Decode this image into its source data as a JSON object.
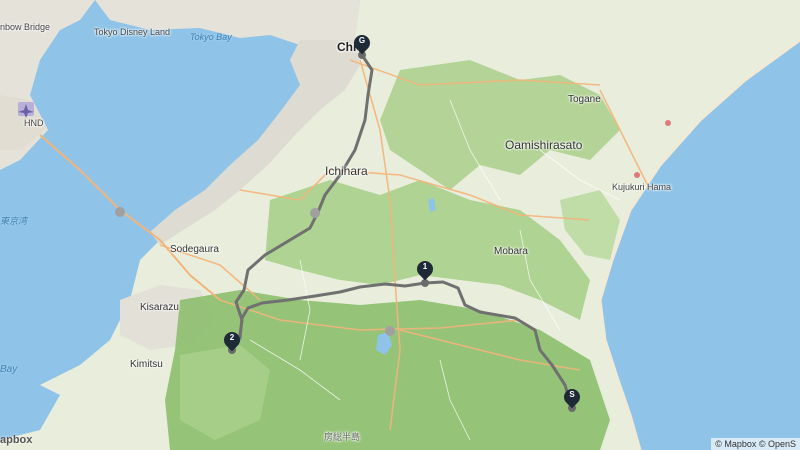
{
  "map": {
    "labels": [
      {
        "id": "rainbow-bridge",
        "text": "nbow Bridge"
      },
      {
        "id": "tokyo-disneyland",
        "text": "Tokyo Disney Land"
      },
      {
        "id": "tokyo-bay",
        "text": "Tokyo Bay"
      },
      {
        "id": "hnd",
        "text": "HND"
      },
      {
        "id": "tokyo-wan",
        "text": "東京湾"
      },
      {
        "id": "chiba",
        "text": "Chi"
      },
      {
        "id": "togane",
        "text": "Togane"
      },
      {
        "id": "oamishirasato",
        "text": "Oamishirasato"
      },
      {
        "id": "ichihara",
        "text": "Ichihara"
      },
      {
        "id": "kujukuri-hama",
        "text": "Kujukuri Hama"
      },
      {
        "id": "sodegaura",
        "text": "Sodegaura"
      },
      {
        "id": "mobara",
        "text": "Mobara"
      },
      {
        "id": "kisarazu",
        "text": "Kisarazu"
      },
      {
        "id": "kimitsu",
        "text": "Kimitsu"
      },
      {
        "id": "bay-left",
        "text": "Bay"
      },
      {
        "id": "boso-hanto",
        "text": "房総半島"
      }
    ],
    "markers": [
      {
        "id": "G",
        "label": "G"
      },
      {
        "id": "1",
        "label": "1"
      },
      {
        "id": "2",
        "label": "2"
      },
      {
        "id": "S",
        "label": "S"
      }
    ],
    "logo": "apbox",
    "attribution": "© Mapbox © OpenS"
  },
  "colors": {
    "water": "#8fc4e8",
    "land": "#e9eedc",
    "forest": "#a9cf8a",
    "forest_dark": "#8cbf6e",
    "urban": "#e5e2da",
    "road": "#f3b47a",
    "route": "#707070",
    "marker": "#1f2a37"
  }
}
